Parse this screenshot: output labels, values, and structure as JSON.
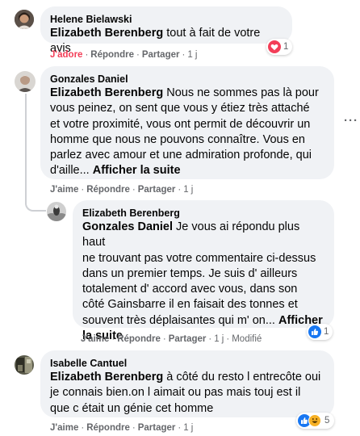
{
  "comments": [
    {
      "author": "Helene Bielawski",
      "mention": "Elizabeth Berenberg",
      "text": " tout à fait de votre avis",
      "actions": {
        "like": "J'adore",
        "reply": "Répondre",
        "share": "Partager",
        "time": "1 j"
      },
      "reaction_count": "1",
      "reaction_icons": [
        "love-icon"
      ]
    },
    {
      "author": "Gonzales Daniel",
      "mention": "Elizabeth Berenberg",
      "lines": [
        " Nous ne sommes pas là pour",
        "vous peinez, on sent que vous y étiez très attaché",
        "et votre proximité, vous ont permit de découvrir un",
        "homme que nous ne pouvons connaître. Vous en",
        "parlez avec amour et une admiration profonde, qui",
        "d'aille... "
      ],
      "see_more": "Afficher la suite",
      "actions": {
        "like": "J'aime",
        "reply": "Répondre",
        "share": "Partager",
        "time": "1 j"
      }
    },
    {
      "author": "Elizabeth Berenberg",
      "mention": "Gonzales Daniel",
      "lines": [
        " Je vous ai répondu plus haut",
        "ne trouvant pas votre commentaire ci-dessus",
        "dans un premier temps. Je suis d' ailleurs",
        "totalement d' accord avec vous, dans son",
        "côté Gainsbarre il en faisait des tonnes et",
        "souvent très déplaisantes qui m' on... "
      ],
      "see_more_a": "Afficher",
      "see_more_b": "la suite",
      "actions": {
        "like": "J'aime",
        "reply": "Répondre",
        "share": "Partager",
        "time": "1 j",
        "edited": "Modifié"
      },
      "reaction_count": "1",
      "reaction_icons": [
        "like-icon"
      ]
    },
    {
      "author": "Isabelle Cantuel",
      "mention": "Elizabeth Berenberg",
      "lines": [
        " à côté du resto l entrecôte oui",
        "je connais bien.on l aimait ou pas mais touj est il",
        "que c était un génie cet homme"
      ],
      "actions": {
        "like": "J'aime",
        "reply": "Répondre",
        "share": "Partager",
        "time": "1 j"
      },
      "reaction_count": "5",
      "reaction_icons": [
        "like-icon",
        "haha-icon"
      ]
    }
  ],
  "more_options": "···",
  "colors": {
    "bubble": "#f0f2f5",
    "meta": "#65676b",
    "love": "#f33e58",
    "like": "#1877f2",
    "haha": "#f7b125",
    "thread": "#ced0d4"
  }
}
